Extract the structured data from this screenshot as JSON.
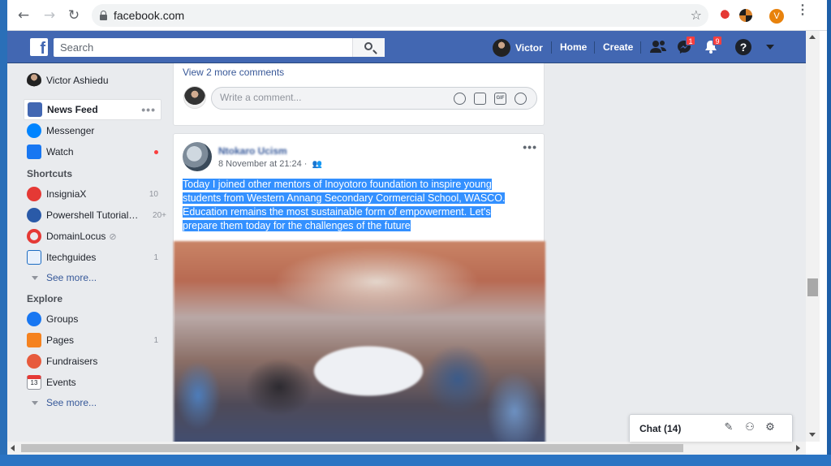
{
  "browser": {
    "url": "facebook.com",
    "profile_initial": "V"
  },
  "fb_header": {
    "logo": "f",
    "search_placeholder": "Search",
    "user_name": "Victor",
    "home": "Home",
    "create": "Create",
    "messenger_badge": "1",
    "notifications_badge": "9",
    "help": "?"
  },
  "sidebar": {
    "profile_name": "Victor Ashiedu",
    "main_items": [
      {
        "label": "News Feed",
        "icon": "news-feed-icon",
        "color": "#4267b2"
      },
      {
        "label": "Messenger",
        "icon": "messenger-icon",
        "color": "#0084ff"
      },
      {
        "label": "Watch",
        "icon": "watch-icon",
        "color": "#1877f2"
      }
    ],
    "shortcuts_heading": "Shortcuts",
    "shortcuts": [
      {
        "label": "InsigniaX",
        "count": "10",
        "color": "#e53935"
      },
      {
        "label": "Powershell Tutorial…",
        "count": "20+",
        "color": "#2a5aa8"
      },
      {
        "label": "DomainLocus",
        "count": "",
        "color": "#e53935"
      },
      {
        "label": "Itechguides",
        "count": "1",
        "color": "#1c6cc2"
      }
    ],
    "shortcuts_more": "See more...",
    "explore_heading": "Explore",
    "explore": [
      {
        "label": "Groups",
        "count": "",
        "color": "#1877f2"
      },
      {
        "label": "Pages",
        "count": "1",
        "color": "#f5821f"
      },
      {
        "label": "Fundraisers",
        "count": "",
        "color": "#e75a3c"
      },
      {
        "label": "Events",
        "count": "",
        "color": "#e53935"
      }
    ],
    "explore_more": "See more..."
  },
  "comment_card": {
    "view_more": "View 2 more comments",
    "placeholder": "Write a comment...",
    "gif": "GIF"
  },
  "post": {
    "author": "Ntokaro Ucism",
    "time": "8 November at 21:24 ·",
    "text_lines": [
      "Today I joined other mentors of Inoyotoro foundation to inspire young",
      "students from Western Annang Secondary Cormercial School, WASCO.",
      "Education remains the most sustainable form of empowerment. Let's",
      "prepare them today for the challenges of the future"
    ]
  },
  "chat": {
    "label": "Chat (14)"
  }
}
